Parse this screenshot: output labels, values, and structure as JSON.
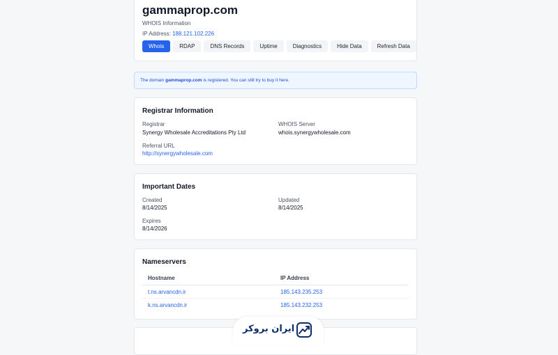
{
  "header": {
    "domain": "gammaprop.com",
    "subtitle": "WHOIS Information",
    "ip_label": "IP Address:",
    "ip_value": "188.121.102.226",
    "tabs": [
      {
        "label": "Whois",
        "active": true
      },
      {
        "label": "RDAP",
        "active": false
      },
      {
        "label": "DNS Records",
        "active": false
      },
      {
        "label": "Uptime",
        "active": false
      },
      {
        "label": "Diagnostics",
        "active": false
      },
      {
        "label": "Hide Data",
        "active": false
      },
      {
        "label": "Refresh Data",
        "active": false
      }
    ]
  },
  "notice": {
    "prefix": "The domain ",
    "domain": "gammaprop.com",
    "suffix": " is registered. You can still try to buy it here."
  },
  "registrar": {
    "title": "Registrar Information",
    "registrar_label": "Registrar",
    "registrar_value": "Synergy Wholesale Accreditations Pty Ltd",
    "whois_label": "WHOIS Server",
    "whois_value": "whois.synergywholesale.com",
    "referral_label": "Referral URL",
    "referral_value": "http://synergywholesale.com"
  },
  "dates": {
    "title": "Important Dates",
    "created_label": "Created",
    "created_value": "8/14/2025",
    "updated_label": "Updated",
    "updated_value": "8/14/2025",
    "expires_label": "Expires",
    "expires_value": "8/14/2026"
  },
  "nameservers": {
    "title": "Nameservers",
    "col_hostname": "Hostname",
    "col_ip": "IP Address",
    "rows": [
      {
        "hostname": "t.ns.arvancdn.ir",
        "ip": "185.143.235.253"
      },
      {
        "hostname": "k.ns.arvancdn.ir",
        "ip": "185.143.232.253"
      }
    ]
  },
  "brand": {
    "name": "ایران بروکر",
    "icon": "chart-trend-icon",
    "color": "#0c2d6b"
  },
  "colors": {
    "accent": "#2563eb",
    "notice_bg": "#eff6ff"
  }
}
